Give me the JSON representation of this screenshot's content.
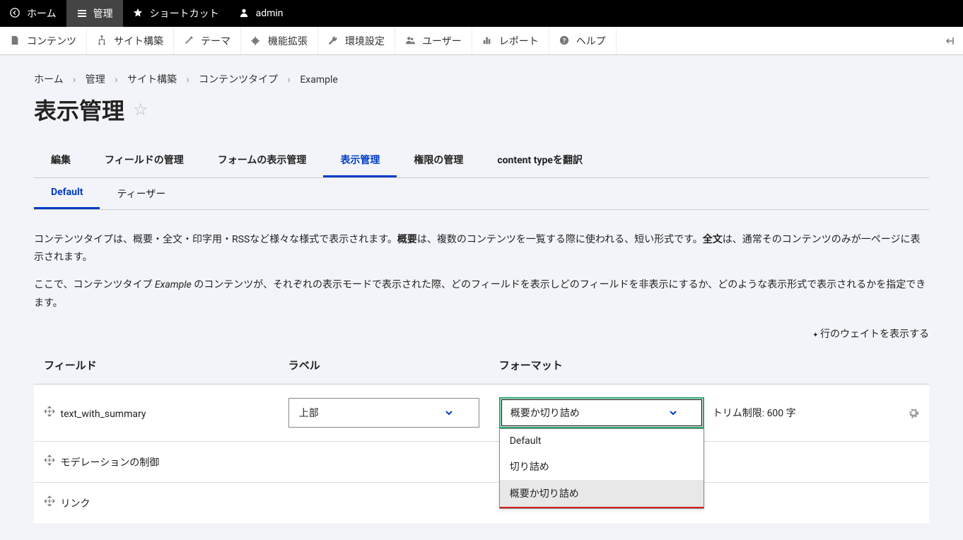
{
  "topbar": {
    "home": "ホーム",
    "manage": "管理",
    "shortcuts": "ショートカット",
    "user": "admin"
  },
  "menubar": {
    "content": "コンテンツ",
    "structure": "サイト構築",
    "theme": "テーマ",
    "extend": "機能拡張",
    "config": "環境設定",
    "users": "ユーザー",
    "reports": "レポート",
    "help": "ヘルプ"
  },
  "breadcrumb": {
    "items": [
      "ホーム",
      "管理",
      "サイト構築",
      "コンテンツタイプ",
      "Example"
    ]
  },
  "page_title": "表示管理",
  "tabs_primary": [
    "編集",
    "フィールドの管理",
    "フォームの表示管理",
    "表示管理",
    "権限の管理",
    "content typeを翻訳"
  ],
  "tabs_primary_active": 3,
  "tabs_secondary": [
    "Default",
    "ティーザー"
  ],
  "tabs_secondary_active": 0,
  "desc": {
    "p1_a": "コンテンツタイプは、概要・全文・印字用・RSSなど様々な様式で表示されます。",
    "p1_strong1": "概要",
    "p1_b": "は、複数のコンテンツを一覧する際に使われる、短い形式です。",
    "p1_strong2": "全文",
    "p1_c": "は、通常そのコンテンツのみが一ページに表示されます。",
    "p2_a": "ここで、コンテンツタイプ ",
    "p2_em": "Example",
    "p2_b": " のコンテンツが、それぞれの表示モードで表示された際、どのフィールドを表示しどのフィールドを非表示にするか、どのような表示形式で表示されるかを指定できます。"
  },
  "weights_link": "行のウェイトを表示する",
  "table": {
    "head": {
      "field": "フィールド",
      "label": "ラベル",
      "format": "フォーマット"
    },
    "rows": [
      {
        "name": "text_with_summary",
        "label_value": "上部",
        "format_value": "概要か切り詰め",
        "trim_text": "トリム制限: 600 字"
      },
      {
        "name": "モデレーションの制御"
      },
      {
        "name": "リンク"
      }
    ]
  },
  "dropdown": {
    "options": [
      "Default",
      "切り詰め",
      "概要か切り詰め"
    ],
    "highlighted": 2
  }
}
